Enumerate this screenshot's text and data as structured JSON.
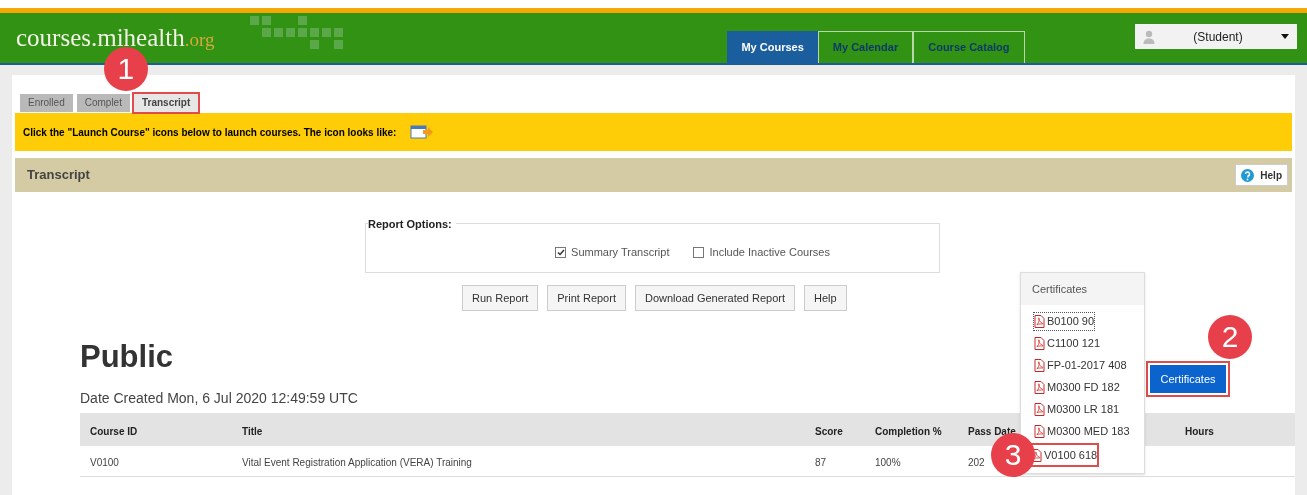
{
  "header": {
    "logo": {
      "main": "courses.mihealth",
      "suffix": ".org"
    },
    "nav_tabs": [
      {
        "label": "My Courses",
        "selected": true
      },
      {
        "label": "My Calendar",
        "selected": false
      },
      {
        "label": "Course Catalog",
        "selected": false
      }
    ],
    "user_menu": {
      "label": "(Student)"
    }
  },
  "tabs": [
    {
      "label": "Enrolled",
      "selected": false,
      "annotated": false
    },
    {
      "label": "Complet",
      "selected": false,
      "annotated": false
    },
    {
      "label": "Transcript",
      "selected": true,
      "annotated": true,
      "callout": "1"
    }
  ],
  "banner": {
    "text": "Click the \"Launch Course\" icons below to launch courses. The icon looks like:"
  },
  "section": {
    "title": "Transcript",
    "help": "Help"
  },
  "report_options": {
    "legend": "Report Options:",
    "options": [
      {
        "label": "Summary Transcript",
        "checked": true
      },
      {
        "label": "Include Inactive Courses",
        "checked": false
      }
    ]
  },
  "buttons": [
    "Run Report",
    "Print Report",
    "Download Generated Report",
    "Help"
  ],
  "report": {
    "heading": "Public",
    "date_created": "Date Created Mon, 6 Jul 2020 12:49:59 UTC"
  },
  "table": {
    "columns": [
      "Course ID",
      "Title",
      "Score",
      "Completion %",
      "Pass Date",
      "Hours"
    ],
    "rows": [
      {
        "cells": [
          "V0100",
          "Vital Event Registration Application (VERA) Training",
          "87",
          "100%",
          "202"
        ]
      }
    ]
  },
  "certificates": {
    "title": "Certificates",
    "button": {
      "label": "Certificates",
      "annotated": true,
      "callout": "2"
    },
    "items": [
      {
        "label": "B0100 90",
        "focused": true,
        "annotated": false
      },
      {
        "label": "C1100 121",
        "focused": false,
        "annotated": false
      },
      {
        "label": "FP-01-2017 408",
        "focused": false,
        "annotated": false
      },
      {
        "label": "M0300 FD 182",
        "focused": false,
        "annotated": false
      },
      {
        "label": "M0300 LR 181",
        "focused": false,
        "annotated": false
      },
      {
        "label": "M0300 MED 183",
        "focused": false,
        "annotated": false
      },
      {
        "label": "V0100 618",
        "focused": false,
        "annotated": true,
        "callout": "3"
      }
    ]
  }
}
